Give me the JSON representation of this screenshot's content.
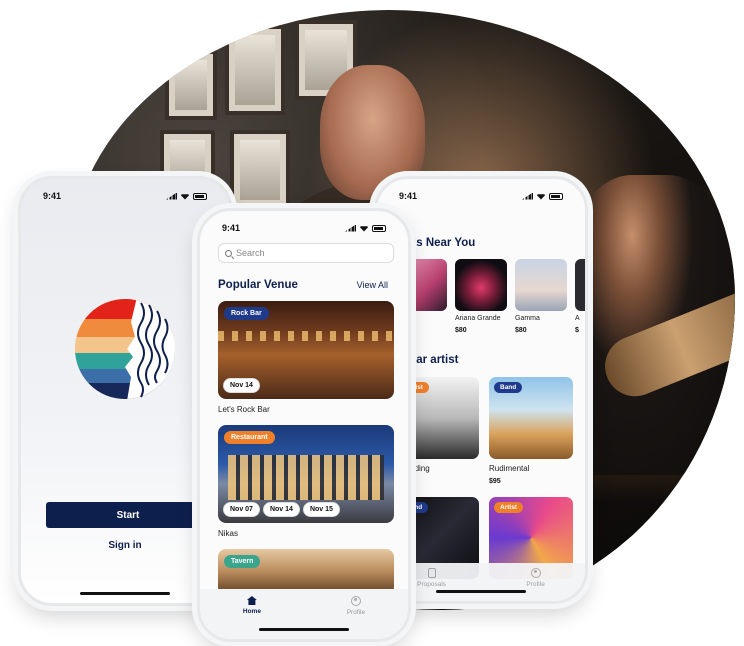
{
  "colors": {
    "navy": "#0d1f4c",
    "tag_blue": "#1f3a8a",
    "tag_orange": "#f07f2a",
    "tag_teal": "#3aa58c"
  },
  "phone_left": {
    "time": "9:41",
    "start_label": "Start",
    "signin_label": "Sign in"
  },
  "phone_center": {
    "time": "9:41",
    "search_placeholder": "Search",
    "section_title": "Popular Venue",
    "view_all": "View All",
    "venues": [
      {
        "tag": "Rock Bar",
        "dates": [
          "Nov 14"
        ],
        "name": "Let's Rock Bar"
      },
      {
        "tag": "Restaurant",
        "dates": [
          "Nov 07",
          "Nov 14",
          "Nov 15"
        ],
        "name": "Nikas"
      },
      {
        "tag": "Tavern",
        "dates": [],
        "name": ""
      }
    ],
    "tabs": [
      {
        "icon": "home-icon",
        "label": "Home"
      },
      {
        "icon": "profile-icon",
        "label": "Profile"
      }
    ]
  },
  "phone_right": {
    "time": "9:41",
    "section1_title": "tists Near You",
    "section2_title": "pular artist",
    "near": [
      {
        "name": "",
        "price": ""
      },
      {
        "name": "Ariana Grande",
        "price": "$80"
      },
      {
        "name": "Gamma",
        "price": "$80"
      },
      {
        "name": "A",
        "price": "$"
      }
    ],
    "popular": [
      {
        "tag": "Artist",
        "name": "n Harding",
        "price": ""
      },
      {
        "tag": "Band",
        "name": "Rudimental",
        "price": "$95"
      },
      {
        "tag": "Band",
        "name": "",
        "price": ""
      },
      {
        "tag": "Artist",
        "name": "",
        "price": ""
      }
    ],
    "tabs": [
      {
        "icon": "proposals-icon",
        "label": "Proposals"
      },
      {
        "icon": "profile-icon",
        "label": "Profile"
      }
    ]
  }
}
